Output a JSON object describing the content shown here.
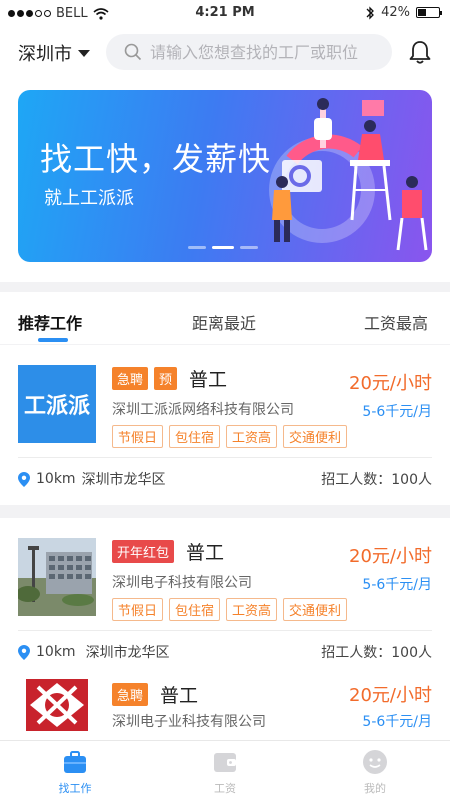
{
  "status_bar": {
    "carrier": "BELL",
    "time": "4:21 PM",
    "battery": "42%",
    "battery_level": 0.42
  },
  "header": {
    "city": "深圳市",
    "search_placeholder": "请输入您想查找的工厂或职位"
  },
  "banner": {
    "headline": "找工快，发薪快",
    "subline": "就上工派派",
    "slides": 3,
    "active_slide": 2
  },
  "tabs": [
    {
      "label": "推荐工作",
      "active": true
    },
    {
      "label": "距离最近",
      "active": false
    },
    {
      "label": "工资最高",
      "active": false
    }
  ],
  "jobs": [
    {
      "badges": [
        {
          "text": "急聘",
          "color": "#f5822b"
        },
        {
          "text": "预",
          "color": "#f5822b"
        }
      ],
      "title": "普工",
      "company": "深圳工派派网络科技有限公司",
      "perks": [
        "节假日",
        "包住宿",
        "工资高",
        "交通便利"
      ],
      "wage": "20元/小时",
      "range": "5-6千元/月",
      "distance": "10km",
      "area": "深圳市龙华区",
      "headcount": "招工人数：100人",
      "logo_text": "工派派"
    },
    {
      "badges": [
        {
          "text": "开年红包",
          "color": "#e84a4a"
        }
      ],
      "title": "普工",
      "company": "深圳电子科技有限公司",
      "perks": [
        "节假日",
        "包住宿",
        "工资高",
        "交通便利"
      ],
      "wage": "20元/小时",
      "range": "5-6千元/月",
      "distance": "10km",
      "area": "深圳市龙华区",
      "headcount": "招工人数：100人"
    },
    {
      "badges": [
        {
          "text": "急聘",
          "color": "#f5822b"
        }
      ],
      "title": "普工",
      "company": "深圳电子业科技有限公司",
      "wage": "20元/小时",
      "range": "5-6千元/月"
    }
  ],
  "bottom_nav": [
    {
      "label": "找工作",
      "icon": "briefcase-icon",
      "active": true
    },
    {
      "label": "工资",
      "icon": "wallet-icon",
      "active": false
    },
    {
      "label": "我的",
      "icon": "profile-icon",
      "active": false
    }
  ],
  "colors": {
    "accent": "#2b8ff3",
    "orange": "#f5822b",
    "red": "#e84a4a",
    "wage": "#f26b2b"
  }
}
